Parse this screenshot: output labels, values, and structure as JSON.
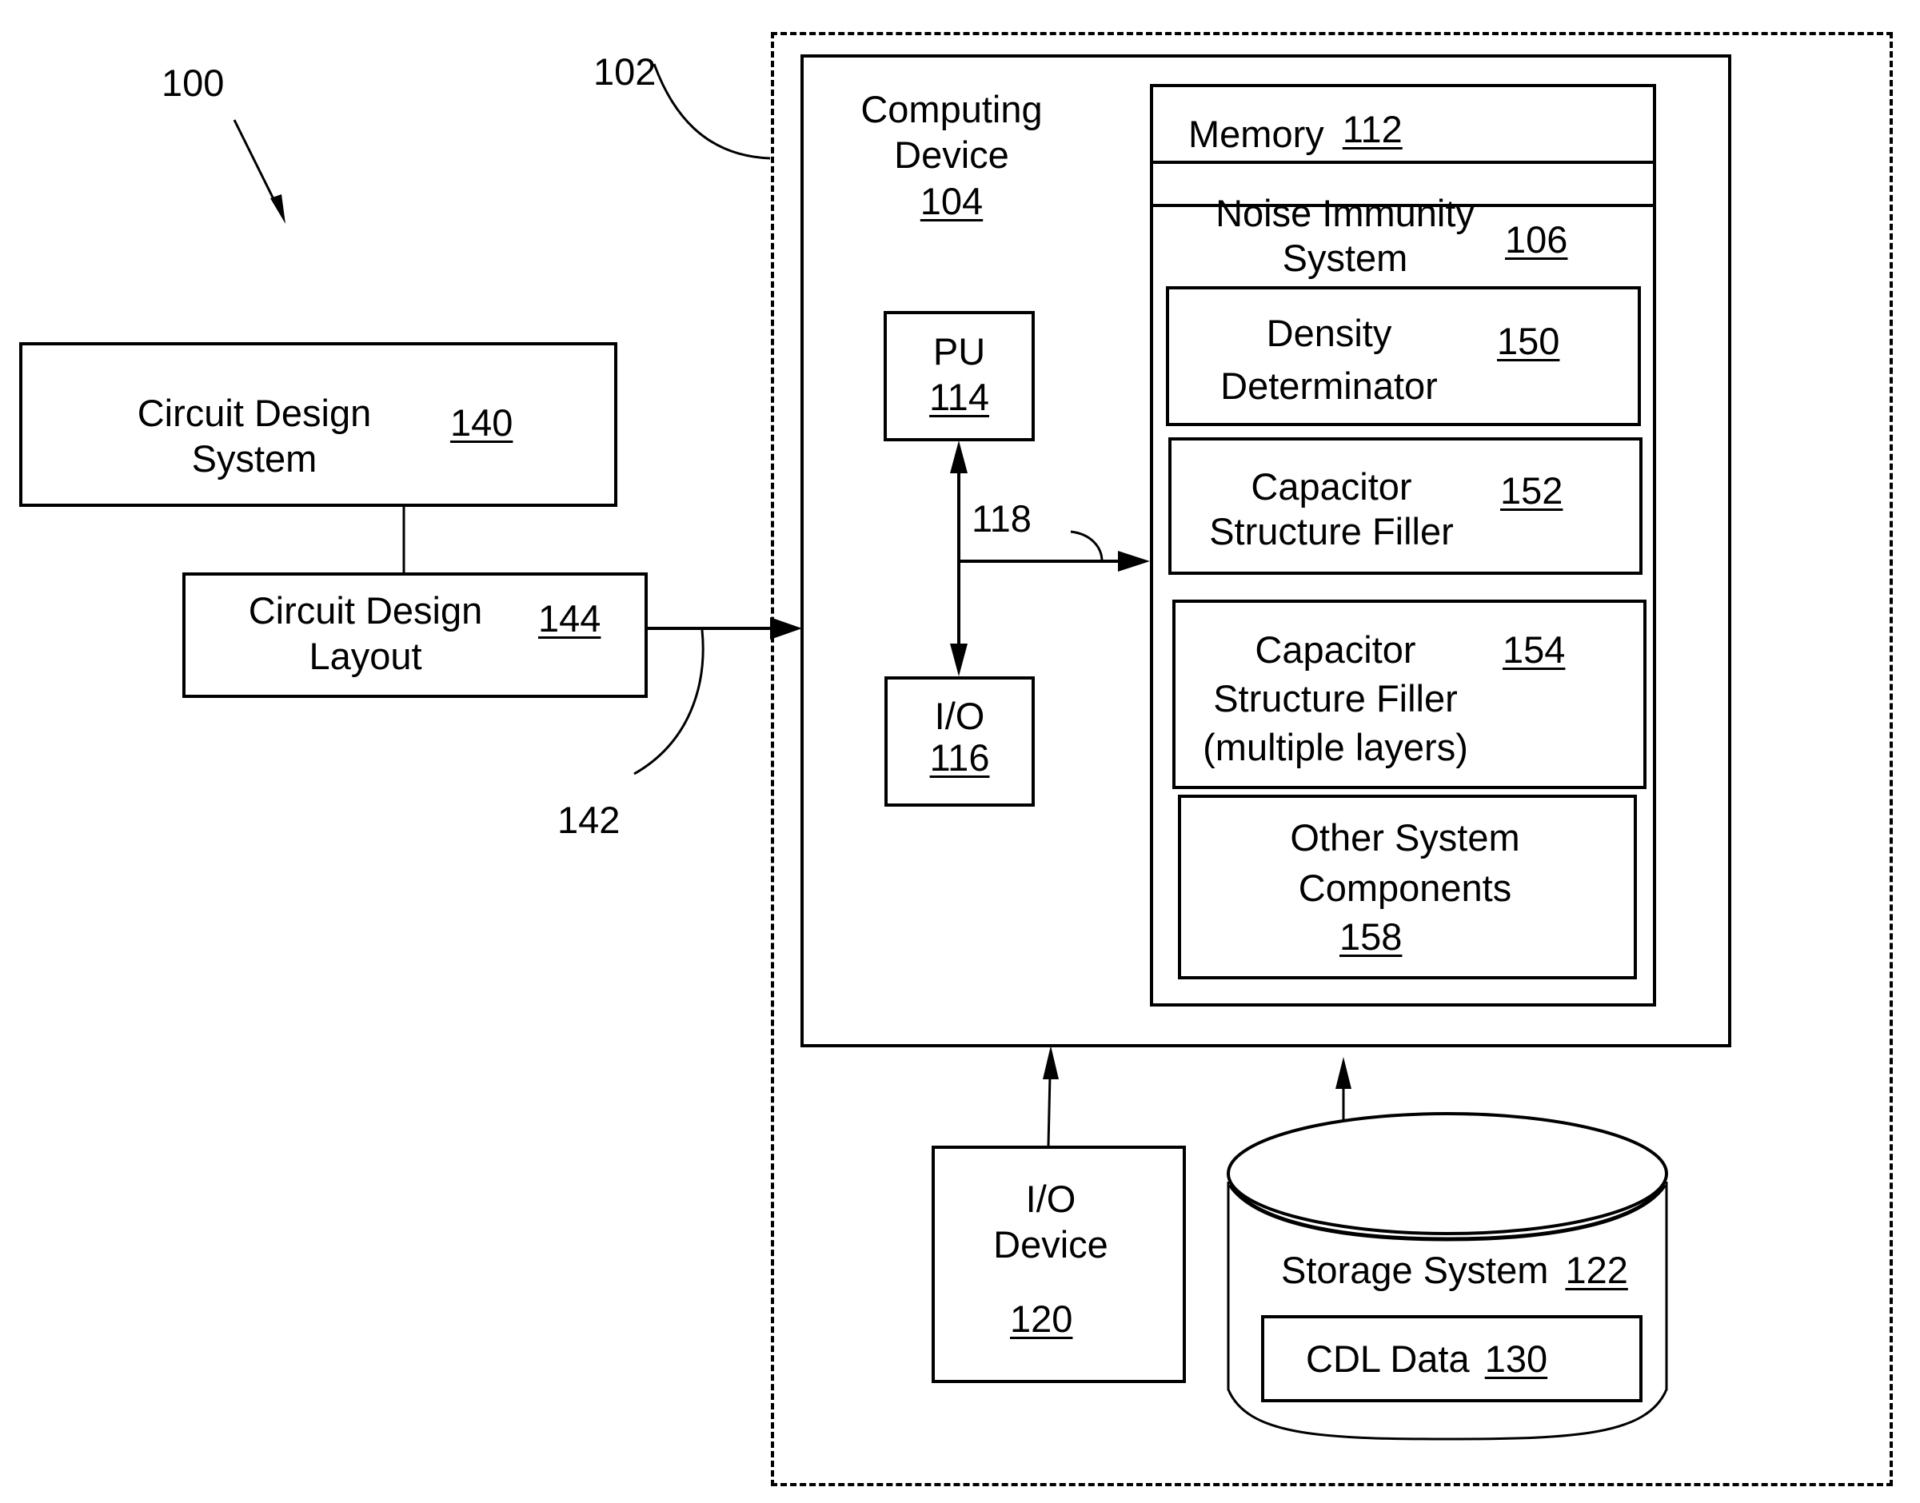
{
  "figure": {
    "system_ref": "100",
    "environment_ref": "102",
    "connection_ref": "142",
    "bus_ref": "118"
  },
  "circuit_design_system": {
    "label_line1": "Circuit Design",
    "label_line2": "System",
    "ref": "140"
  },
  "circuit_design_layout": {
    "label_line1": "Circuit Design",
    "label_line2": "Layout",
    "ref": "144"
  },
  "computing_device": {
    "label_line1": "Computing",
    "label_line2": "Device",
    "ref": "104",
    "pu": {
      "label": "PU",
      "ref": "114"
    },
    "io": {
      "label": "I/O",
      "ref": "116"
    },
    "memory": {
      "label": "Memory",
      "ref": "112",
      "noise_immunity_system": {
        "label_line1": "Noise Immunity",
        "label_line2": "System",
        "ref": "106"
      },
      "components": [
        {
          "lines": [
            "Density",
            "Determinator"
          ],
          "ref": "150"
        },
        {
          "lines": [
            "Capacitor",
            "Structure Filler"
          ],
          "ref": "152"
        },
        {
          "lines": [
            "Capacitor",
            "Structure Filler",
            "(multiple layers)"
          ],
          "ref": "154"
        },
        {
          "lines": [
            "Other System",
            "Components"
          ],
          "ref": "158"
        }
      ]
    }
  },
  "io_device": {
    "label_line1": "I/O",
    "label_line2": "Device",
    "ref": "120"
  },
  "storage_system": {
    "label": "Storage System",
    "ref": "122",
    "cdl_data": {
      "label": "CDL Data",
      "ref": "130"
    }
  }
}
